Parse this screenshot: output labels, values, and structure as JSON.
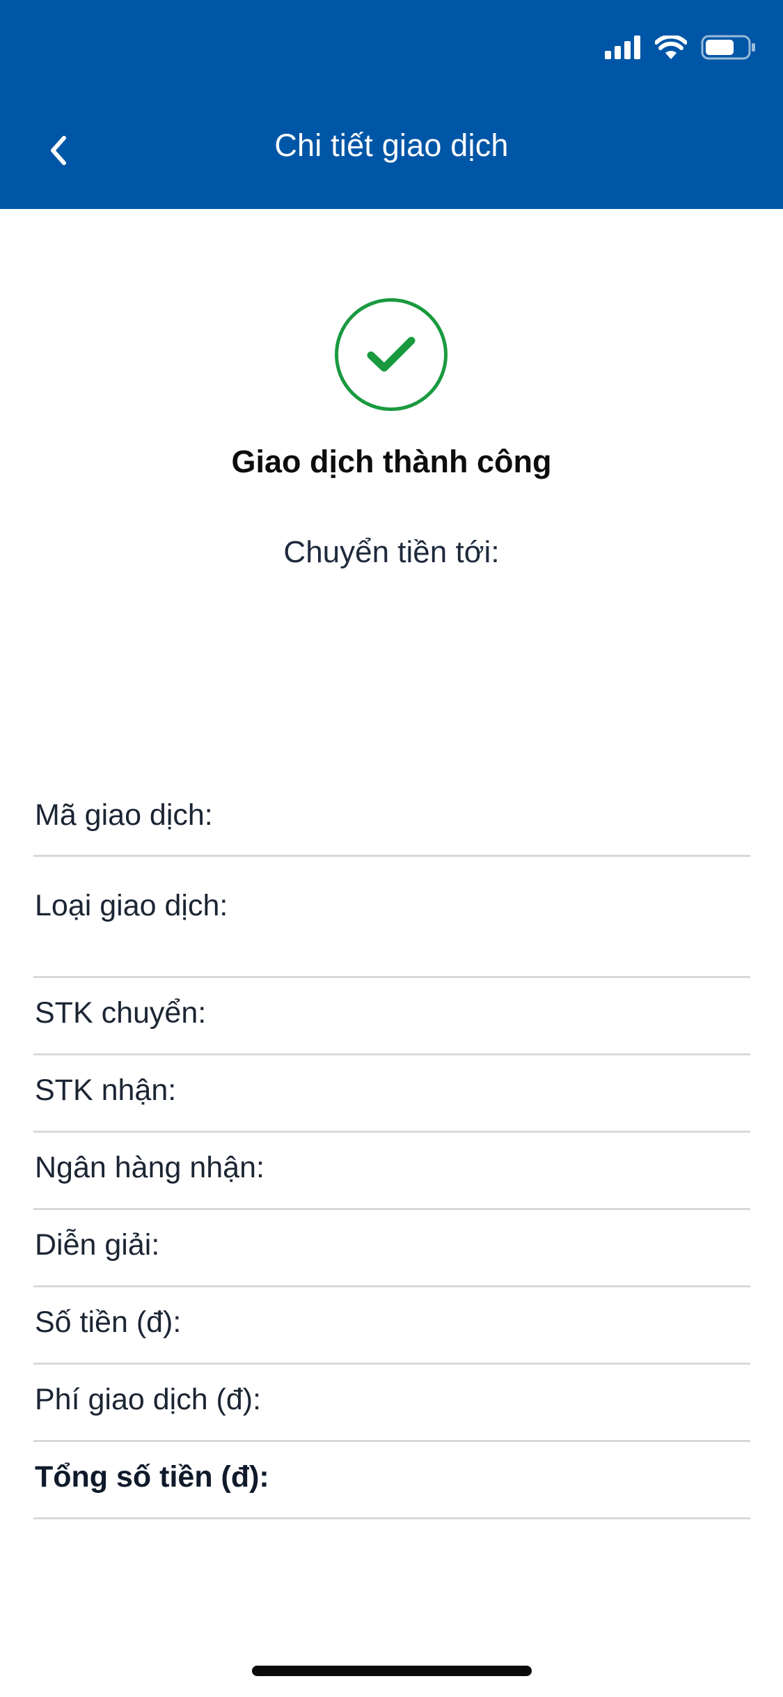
{
  "header": {
    "title": "Chi tiết giao dịch",
    "background_color": "#0056a6",
    "back_icon": "chevron-left-icon"
  },
  "status_bar": {
    "icons": [
      "signal-icon",
      "wifi-icon",
      "battery-icon"
    ]
  },
  "success": {
    "icon": "check-circle-icon",
    "accent_color": "#1a9a3f",
    "title": "Giao dịch thành công",
    "transfer_to": "Chuyển tiền tới:"
  },
  "details": {
    "rows": [
      {
        "label": "Mã giao dịch:"
      },
      {
        "label": "Loại giao dịch:"
      },
      {
        "label": "STK chuyển:"
      },
      {
        "label": "STK nhận:"
      },
      {
        "label": "Ngân hàng nhận:"
      },
      {
        "label": "Diễn giải:"
      },
      {
        "label": "Số tiền (đ):"
      },
      {
        "label": "Phí giao dịch (đ):"
      },
      {
        "label": "Tổng số tiền (đ):"
      }
    ]
  }
}
